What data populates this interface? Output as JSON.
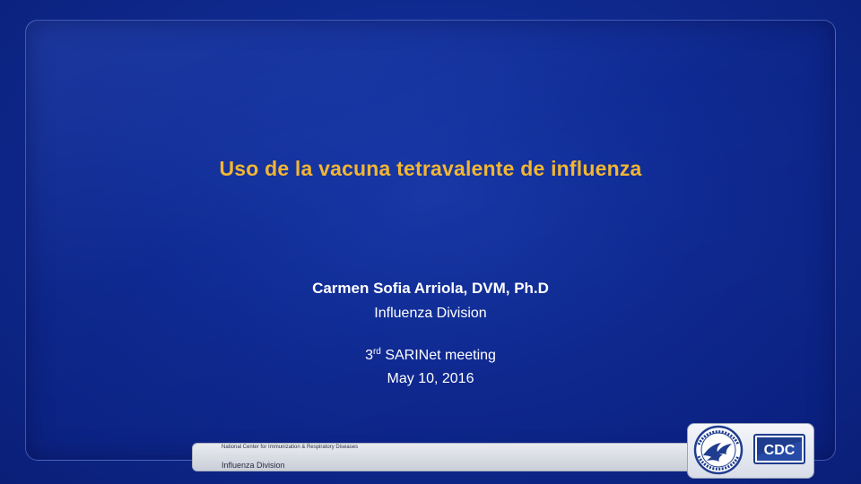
{
  "slide": {
    "title": "Uso de la vacuna tetravalente de influenza",
    "author": "Carmen Sofia Arriola, DVM, Ph.D",
    "division": "Influenza Division",
    "meeting_number": "3",
    "meeting_suffix": "rd",
    "meeting_name": " SARINet meeting",
    "date": "May 10, 2016"
  },
  "footer": {
    "center_name": "National Center for Immunization & Respiratory Diseases",
    "division": "Influenza Division"
  },
  "logos": {
    "cdc_text": "CDC",
    "hhs_icon": "hhs-seal-icon",
    "cdc_icon": "cdc-logo-icon"
  },
  "colors": {
    "background": "#0f2a90",
    "title": "#f2b632",
    "text": "#ffffff",
    "cdc_blue": "#1f3d8f"
  }
}
